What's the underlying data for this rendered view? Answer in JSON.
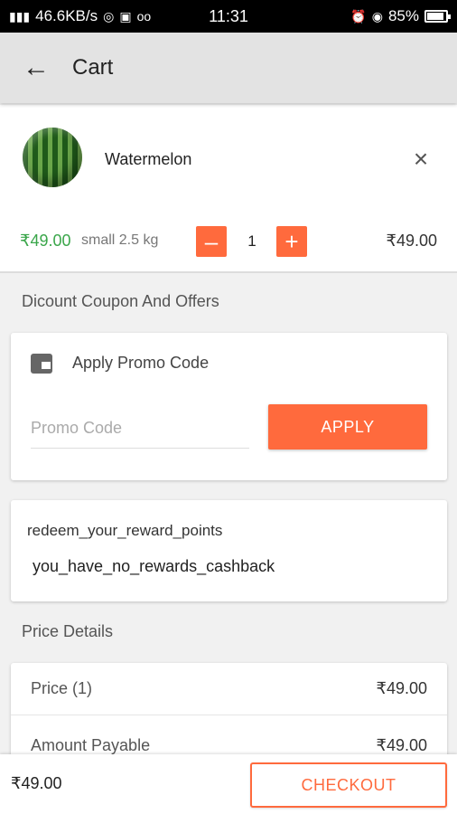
{
  "status_bar": {
    "network_speed": "46.6KB/s",
    "time": "11:31",
    "battery": "85%"
  },
  "toolbar": {
    "title": "Cart"
  },
  "cart_item": {
    "name": "Watermelon",
    "unit_price": "₹49.00",
    "size": "small 2.5 kg",
    "quantity": "1",
    "minus_label": "–",
    "plus_label": "+",
    "line_total": "₹49.00",
    "remove_label": "×"
  },
  "coupon_section": {
    "title": "Dicount Coupon And Offers",
    "promo_title": "Apply Promo Code",
    "promo_placeholder": "Promo Code",
    "apply_label": "APPLY"
  },
  "rewards": {
    "title": "redeem_your_reward_points",
    "message": "you_have_no_rewards_cashback"
  },
  "price_details": {
    "title": "Price Details",
    "rows": [
      {
        "label": "Price (1)",
        "value": "₹49.00"
      },
      {
        "label": "Amount Payable",
        "value": "₹49.00"
      }
    ]
  },
  "bottom_bar": {
    "total": "₹49.00",
    "checkout_label": "CHECKOUT"
  },
  "colors": {
    "accent": "#ff6a3d",
    "price_green": "#3aa64a"
  }
}
